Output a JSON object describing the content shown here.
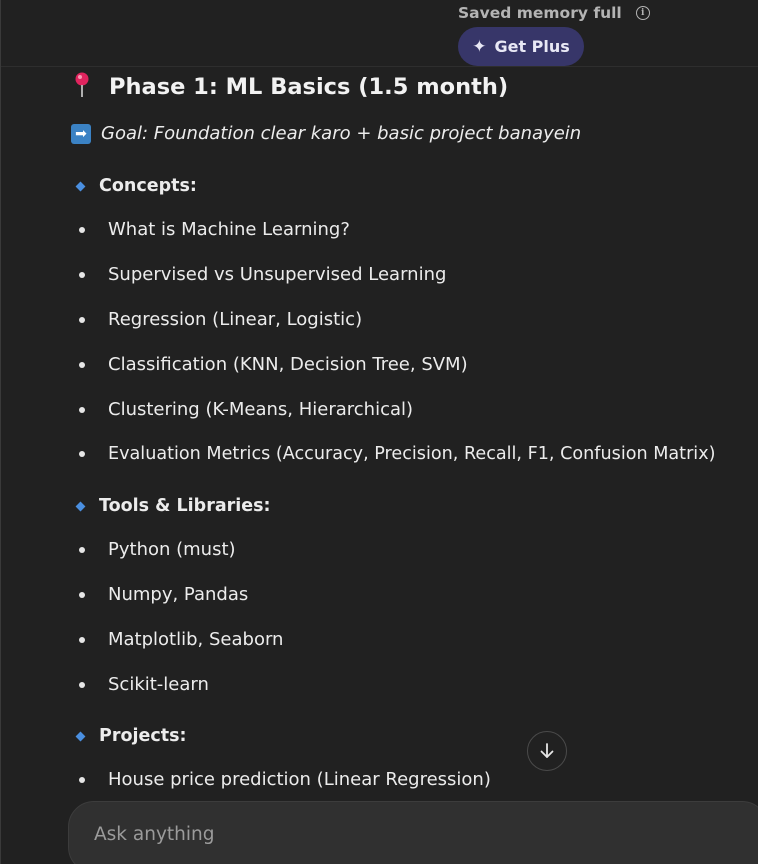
{
  "header": {
    "memory_status": "Saved memory full",
    "plus_label": "Get Plus"
  },
  "message": {
    "title": "Phase 1: ML Basics (1.5 month)",
    "goal": "Goal: Foundation clear karo + basic project banayein",
    "sections": [
      {
        "heading": "Concepts:",
        "items": [
          "What is Machine Learning?",
          "Supervised vs Unsupervised Learning",
          "Regression (Linear, Logistic)",
          "Classification (KNN, Decision Tree, SVM)",
          "Clustering (K-Means, Hierarchical)",
          "Evaluation Metrics (Accuracy, Precision, Recall, F1, Confusion Matrix)"
        ]
      },
      {
        "heading": "Tools & Libraries:",
        "items": [
          "Python (must)",
          "Numpy, Pandas",
          "Matplotlib, Seaborn",
          "Scikit-learn"
        ]
      },
      {
        "heading": "Projects:",
        "items": [
          "House price prediction (Linear Regression)"
        ]
      }
    ]
  },
  "composer": {
    "placeholder": "Ask anything"
  },
  "icons": {
    "title": "pin-icon",
    "goal": "arrow-right-icon",
    "section": "diamond-icon",
    "scroll": "arrow-down-icon",
    "plus": "sparkle-icon",
    "memory": "info-icon"
  }
}
